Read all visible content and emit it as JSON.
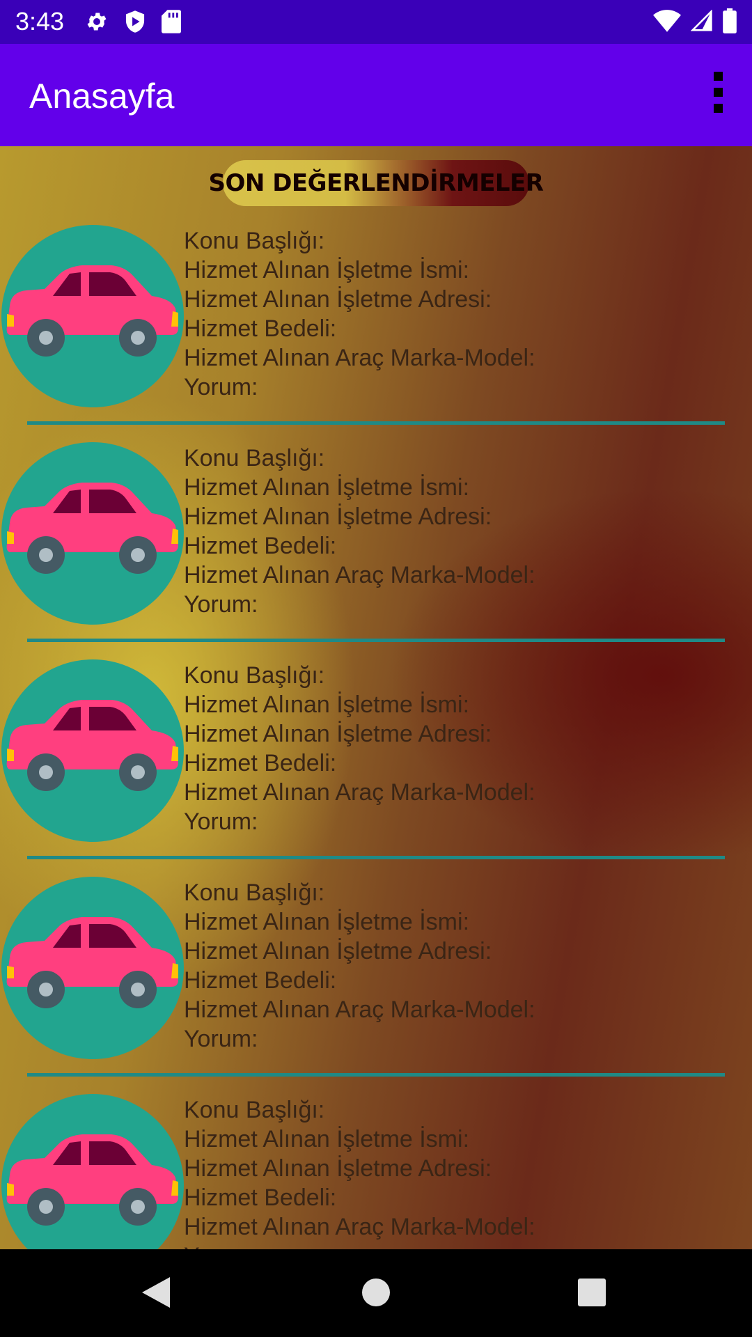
{
  "status_bar": {
    "time": "3:43",
    "icons_left": [
      "gear-icon",
      "shield-play-icon",
      "sd-card-icon"
    ],
    "icons_right": [
      "wifi-icon",
      "signal-icon",
      "battery-icon"
    ]
  },
  "app_bar": {
    "title": "Anasayfa",
    "menu_icon": "overflow-menu-icon"
  },
  "header": {
    "label": "SON DEĞERLENDİRMELER"
  },
  "reviews": [
    {
      "avatar_icon": "car-icon",
      "fields": [
        "Konu Başlığı:",
        "Hizmet Alınan İşletme İsmi:",
        "Hizmet Alınan İşletme Adresi:",
        "Hizmet Bedeli:",
        "Hizmet Alınan Araç Marka-Model:",
        "Yorum:"
      ]
    },
    {
      "avatar_icon": "car-icon",
      "fields": [
        "Konu Başlığı:",
        "Hizmet Alınan İşletme İsmi:",
        "Hizmet Alınan İşletme Adresi:",
        "Hizmet Bedeli:",
        "Hizmet Alınan Araç Marka-Model:",
        "Yorum:"
      ]
    },
    {
      "avatar_icon": "car-icon",
      "fields": [
        "Konu Başlığı:",
        "Hizmet Alınan İşletme İsmi:",
        "Hizmet Alınan İşletme Adresi:",
        "Hizmet Bedeli:",
        "Hizmet Alınan Araç Marka-Model:",
        "Yorum:"
      ]
    },
    {
      "avatar_icon": "car-icon",
      "fields": [
        "Konu Başlığı:",
        "Hizmet Alınan İşletme İsmi:",
        "Hizmet Alınan İşletme Adresi:",
        "Hizmet Bedeli:",
        "Hizmet Alınan Araç Marka-Model:",
        "Yorum:"
      ]
    },
    {
      "avatar_icon": "car-icon",
      "fields": [
        "Konu Başlığı:",
        "Hizmet Alınan İşletme İsmi:",
        "Hizmet Alınan İşletme Adresi:",
        "Hizmet Bedeli:",
        "Hizmet Alınan Araç Marka-Model:",
        "Yorum:"
      ]
    }
  ],
  "nav_bar": {
    "buttons": [
      "back-icon",
      "home-icon",
      "recents-icon"
    ]
  },
  "colors": {
    "status_bar": "#3a00b8",
    "app_bar": "#6200ea",
    "avatar_bg": "#22a58f",
    "car_body": "#ff3f7f",
    "car_window": "#6b0035",
    "divider": "#1f8a86"
  }
}
